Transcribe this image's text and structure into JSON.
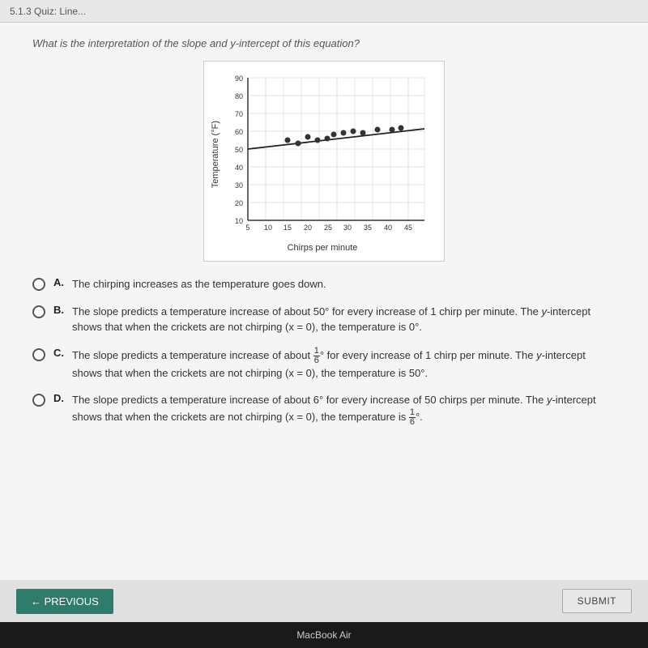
{
  "topbar": {
    "label": "5.1.3 Quiz: Line..."
  },
  "question": {
    "text": "What is the interpretation of the slope and y-intercept of this equation?"
  },
  "chart": {
    "title": "",
    "y_axis_label": "Temperature (°F)",
    "x_axis_label": "Chirps per minute",
    "x_ticks": [
      "5",
      "10",
      "15",
      "20",
      "25",
      "30",
      "35",
      "40",
      "45"
    ],
    "y_ticks": [
      "10",
      "20",
      "30",
      "40",
      "50",
      "60",
      "70",
      "80",
      "90"
    ],
    "data_points": [
      {
        "x": 15,
        "y": 55
      },
      {
        "x": 17,
        "y": 53
      },
      {
        "x": 20,
        "y": 57
      },
      {
        "x": 22,
        "y": 55
      },
      {
        "x": 24,
        "y": 56
      },
      {
        "x": 25,
        "y": 58
      },
      {
        "x": 27,
        "y": 59
      },
      {
        "x": 30,
        "y": 60
      },
      {
        "x": 32,
        "y": 59
      },
      {
        "x": 35,
        "y": 61
      },
      {
        "x": 38,
        "y": 61
      },
      {
        "x": 40,
        "y": 62
      }
    ]
  },
  "answers": [
    {
      "letter": "A.",
      "text": "The chirping increases as the temperature goes down."
    },
    {
      "letter": "B.",
      "text": "The slope predicts a temperature increase of about 50° for every increase of 1 chirp per minute. The y-intercept shows that when the crickets are not chirping (x = 0), the temperature is 0°."
    },
    {
      "letter": "C.",
      "text": "The slope predicts a temperature increase of about 1/6° for every increase of 1 chirp per minute. The y-intercept shows that when the crickets are not chirping (x = 0), the temperature is 50°."
    },
    {
      "letter": "D.",
      "text": "The slope predicts a temperature increase of about 6° for every increase of 50 chirps per minute. The y-intercept shows that when the crickets are not chirping (x = 0), the temperature is 1/6°."
    }
  ],
  "buttons": {
    "previous": "← PREVIOUS",
    "submit": "SUBMIT"
  },
  "macbook": "MacBook Air"
}
